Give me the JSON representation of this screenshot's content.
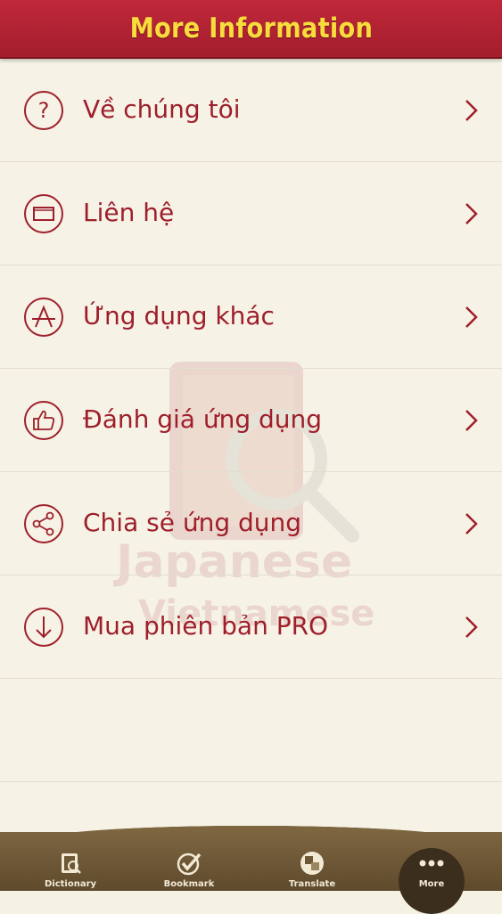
{
  "header": {
    "title": "More Information"
  },
  "menu": {
    "items": [
      {
        "label": "Về chúng tôi",
        "icon": "question-icon"
      },
      {
        "label": "Liên hệ",
        "icon": "mail-icon"
      },
      {
        "label": "Ứng dụng khác",
        "icon": "app-store-icon"
      },
      {
        "label": "Đánh giá ứng dụng",
        "icon": "thumbs-up-icon"
      },
      {
        "label": "Chia sẻ ứng dụng",
        "icon": "share-icon"
      },
      {
        "label": "Mua phiên bản PRO",
        "icon": "download-icon"
      }
    ]
  },
  "watermark": {
    "line1": "Japanese",
    "line2": "Vietnamese"
  },
  "tabbar": {
    "tabs": [
      {
        "label": "Dictionary",
        "icon": "dictionary-icon"
      },
      {
        "label": "Bookmark",
        "icon": "bookmark-check-icon"
      },
      {
        "label": "Translate",
        "icon": "translate-icon"
      },
      {
        "label": "More",
        "icon": "more-dots-icon",
        "active": true
      }
    ]
  },
  "colors": {
    "accent": "#9e1f2b",
    "header_bg": "#b32233",
    "header_text": "#f8dc3c",
    "tabbar_bg": "#6e5836"
  }
}
